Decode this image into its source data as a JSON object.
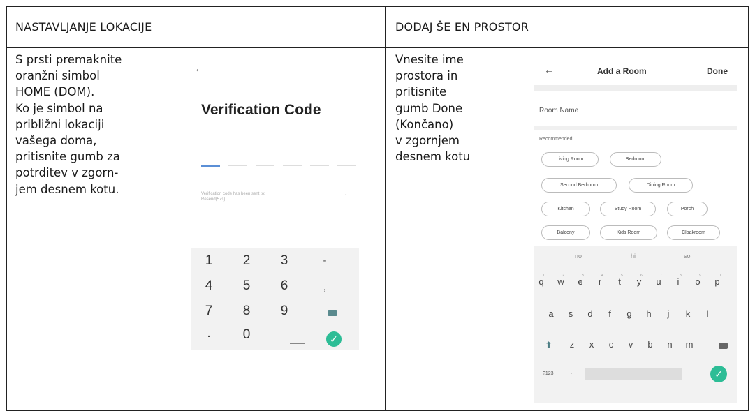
{
  "left": {
    "heading": "NASTAVLJANJE LOKACIJE",
    "description": [
      "S prsti premaknite",
      "oranžni simbol",
      "HOME (DOM).",
      "Ko je simbol na",
      "približni lokaciji",
      "vašega doma,",
      "pritisnite gumb za",
      "potrditev v zgorn-",
      "jem desnem kotu."
    ],
    "phone": {
      "back_icon": "←",
      "title": "Verification Code",
      "sent_text": "Verification code has been sent to:",
      "resend_text": "Resend(57s)",
      "dash": "-",
      "keypad": [
        [
          "1",
          "2",
          "3",
          "-"
        ],
        [
          "4",
          "5",
          "6",
          ","
        ],
        [
          "7",
          "8",
          "9",
          "backspace-icon"
        ],
        [
          ".",
          "0",
          "space-icon",
          "check-icon"
        ]
      ]
    }
  },
  "right": {
    "heading": "DODAJ ŠE EN PROSTOR",
    "description": [
      "Vnesite ime",
      "prostora in",
      "pritisnite",
      "gumb Done",
      "(Končano)",
      "v zgornjem",
      "desnem kotu"
    ],
    "phone": {
      "back_icon": "←",
      "title": "Add a Room",
      "done": "Done",
      "room_name_label": "Room Name",
      "recommended_label": "Recommended",
      "rooms": [
        "Living Room",
        "Bedroom",
        "Second Bedroom",
        "Dining Room",
        "Kitchen",
        "Study Room",
        "Porch",
        "Balcony",
        "Kids Room",
        "Cloakroom"
      ],
      "suggestions": [
        "no",
        "hi",
        "so"
      ],
      "row1": [
        "q",
        "w",
        "e",
        "r",
        "t",
        "y",
        "u",
        "i",
        "o",
        "p"
      ],
      "row1_nums": [
        "1",
        "2",
        "3",
        "4",
        "5",
        "6",
        "7",
        "8",
        "9",
        "0"
      ],
      "row2": [
        "a",
        "s",
        "d",
        "f",
        "g",
        "h",
        "j",
        "k",
        "l"
      ],
      "row3": [
        "z",
        "x",
        "c",
        "v",
        "b",
        "n",
        "m"
      ],
      "sym_key": "?123",
      "comma": ",",
      "period": "."
    }
  },
  "colors": {
    "accent": "#2dbd96",
    "active_line": "#5b8fd6"
  }
}
